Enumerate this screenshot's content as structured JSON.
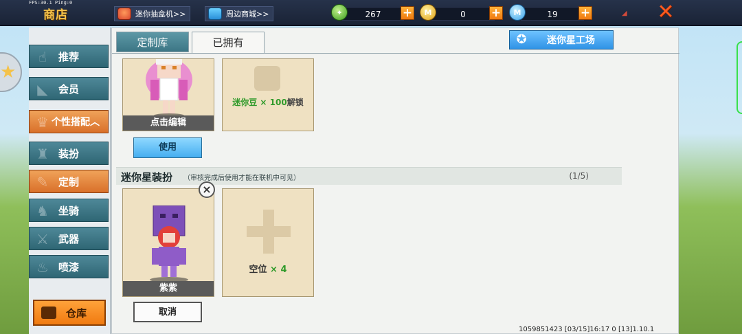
{
  "topbar": {
    "fps": "FPS:30.1  Ping:0",
    "shop_title": "商店",
    "lucky_box_link": "迷你抽盒机>>",
    "merch_link": "周边商城>>",
    "currencies": [
      {
        "name": "green-gem",
        "value": "267"
      },
      {
        "name": "gold-coin",
        "value": "0"
      },
      {
        "name": "blue-coin",
        "value": "19"
      }
    ]
  },
  "sidemenu": {
    "items": [
      {
        "label": "推荐",
        "active": false
      },
      {
        "label": "会员",
        "active": false
      },
      {
        "label": "个性搭配︿",
        "active": true
      },
      {
        "label": "装扮",
        "active": false
      },
      {
        "label": "定制",
        "active": true
      },
      {
        "label": "坐骑",
        "active": false
      },
      {
        "label": "武器",
        "active": false
      },
      {
        "label": "喷漆",
        "active": false
      }
    ],
    "warehouse": "仓库"
  },
  "tabs": {
    "library": "定制库",
    "owned": "已拥有"
  },
  "studio_button": "迷你星工场",
  "top_section": {
    "card1_label": "点击编辑",
    "card2_unlock_green": "迷你豆 × 100",
    "card2_unlock_suffix": "解锁",
    "use_button": "使用"
  },
  "mini_star_section": {
    "title": "迷你星装扮",
    "note": "（审核完成后使用才能在联机中可见）",
    "count": "(1/5)",
    "card1_label": "紫紫",
    "empty_label": "空位",
    "empty_count": "× 4",
    "cancel_button": "取消"
  },
  "footer": "1059851423    [03/15]16:17 0    [13]1.10.1",
  "colors": {
    "accent_orange": "#f07a10",
    "teal_tab": "#3c7685",
    "unlock_green": "#2f9a2a"
  }
}
